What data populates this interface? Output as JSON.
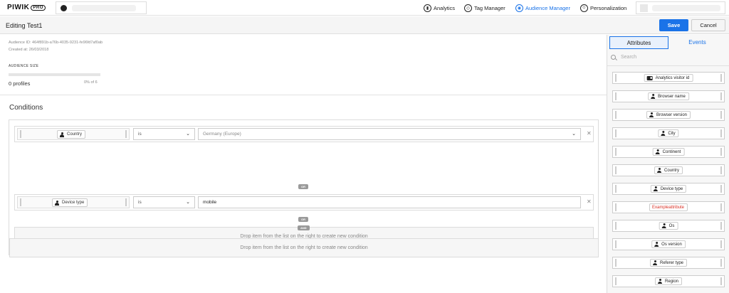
{
  "app": {
    "logo": "PIWIK",
    "logo_badge": "PRO"
  },
  "nav": [
    {
      "label": "Analytics",
      "icon": "analytics-icon"
    },
    {
      "label": "Tag Manager",
      "icon": "tag-manager-icon"
    },
    {
      "label": "Audience Manager",
      "icon": "audience-manager-icon",
      "active": true
    },
    {
      "label": "Personalization",
      "icon": "personalization-icon"
    }
  ],
  "header": {
    "title": "Editing Test1",
    "save_label": "Save",
    "cancel_label": "Cancel"
  },
  "audience": {
    "id_text": "Audience ID: 464f891b-a76b-4035-9231-fe96fd7af0ab",
    "created_text": "Created at: 26/03/2018",
    "size_label": "AUDIENCE SIZE",
    "profiles": "0 profiles",
    "percent": "0% of 6",
    "size_fraction": 0
  },
  "conditions": {
    "title": "Conditions",
    "rows": [
      {
        "attribute": "Country",
        "operator": "is",
        "value": "Germany (Europe)",
        "value_is_select": true
      },
      {
        "attribute": "Device type",
        "operator": "is",
        "value": "mobile",
        "value_is_select": false
      }
    ],
    "or_label": "OR",
    "and_label": "AND",
    "drop_text": "Drop item from the list on the right to create new condition"
  },
  "sidebar": {
    "tabs": [
      {
        "label": "Attributes",
        "active": true
      },
      {
        "label": "Events",
        "active": false
      }
    ],
    "search_placeholder": "Search",
    "items": [
      {
        "label": "Analytics visitor id",
        "icon": "id-card-icon"
      },
      {
        "label": "Browser name",
        "icon": "person-icon"
      },
      {
        "label": "Browser version",
        "icon": "person-icon"
      },
      {
        "label": "City",
        "icon": "person-icon"
      },
      {
        "label": "Continent",
        "icon": "person-icon"
      },
      {
        "label": "Country",
        "icon": "person-icon"
      },
      {
        "label": "Device type",
        "icon": "person-icon"
      },
      {
        "label": "Exampleattribute",
        "icon": "none",
        "color": "#d93025"
      },
      {
        "label": "Os",
        "icon": "person-icon"
      },
      {
        "label": "Os version",
        "icon": "person-icon"
      },
      {
        "label": "Referer type",
        "icon": "person-icon"
      },
      {
        "label": "Region",
        "icon": "person-icon"
      }
    ]
  },
  "colors": {
    "accent": "#1a73e8",
    "error_red": "#d93025"
  }
}
